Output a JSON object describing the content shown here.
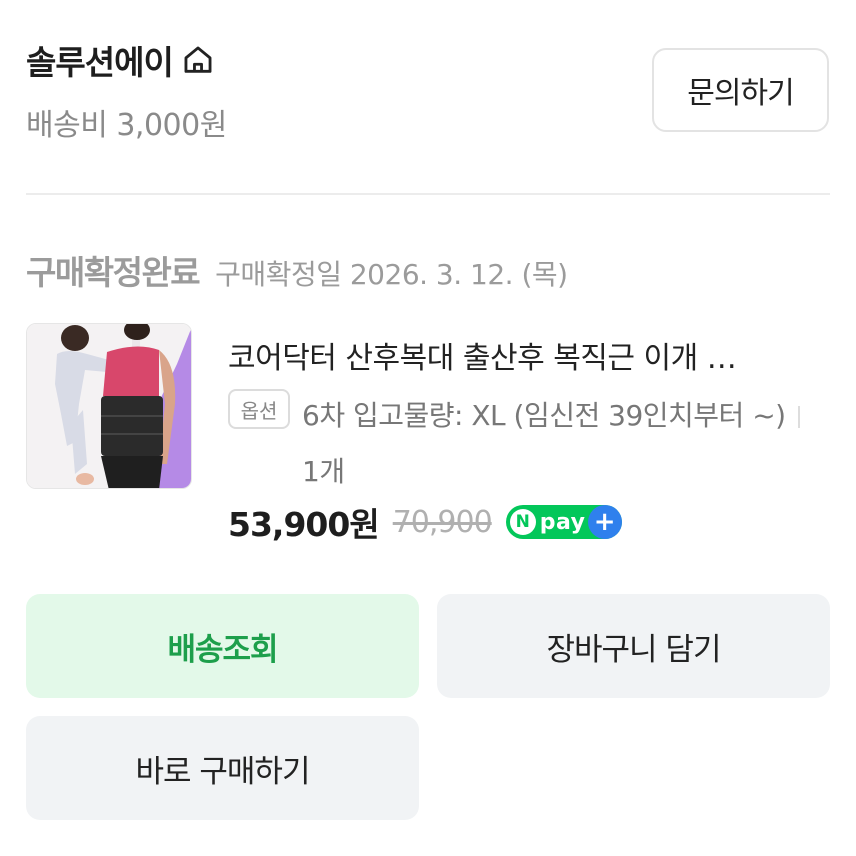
{
  "seller": {
    "name": "솔루션에이",
    "home_icon": "home-icon",
    "shipping_fee": "배송비 3,000원",
    "inquiry_label": "문의하기"
  },
  "order": {
    "status_label": "구매확정완료",
    "status_date": "구매확정일 2026. 3. 12. (목)"
  },
  "product": {
    "title": "코어닥터 산후복대 출산후 복직근 이개 …",
    "option_badge": "옵션",
    "option_value": "6차 입고물량: XL (임신전 39인치부터 ~)",
    "quantity": "1개",
    "price": "53,900원",
    "original_price": "70,900",
    "npay_badge": {
      "n": "N",
      "text": "pay",
      "plus": "+"
    },
    "colors": {
      "npay_green": "#03c75a",
      "npay_blue": "#2f80ed"
    }
  },
  "actions": {
    "track_label": "배송조회",
    "cart_label": "장바구니 담기",
    "buy_label": "바로 구매하기"
  },
  "colors": {
    "track_bg": "#e3f9e9",
    "track_text": "#1d9f4b",
    "secondary_bg": "#f1f3f5"
  }
}
